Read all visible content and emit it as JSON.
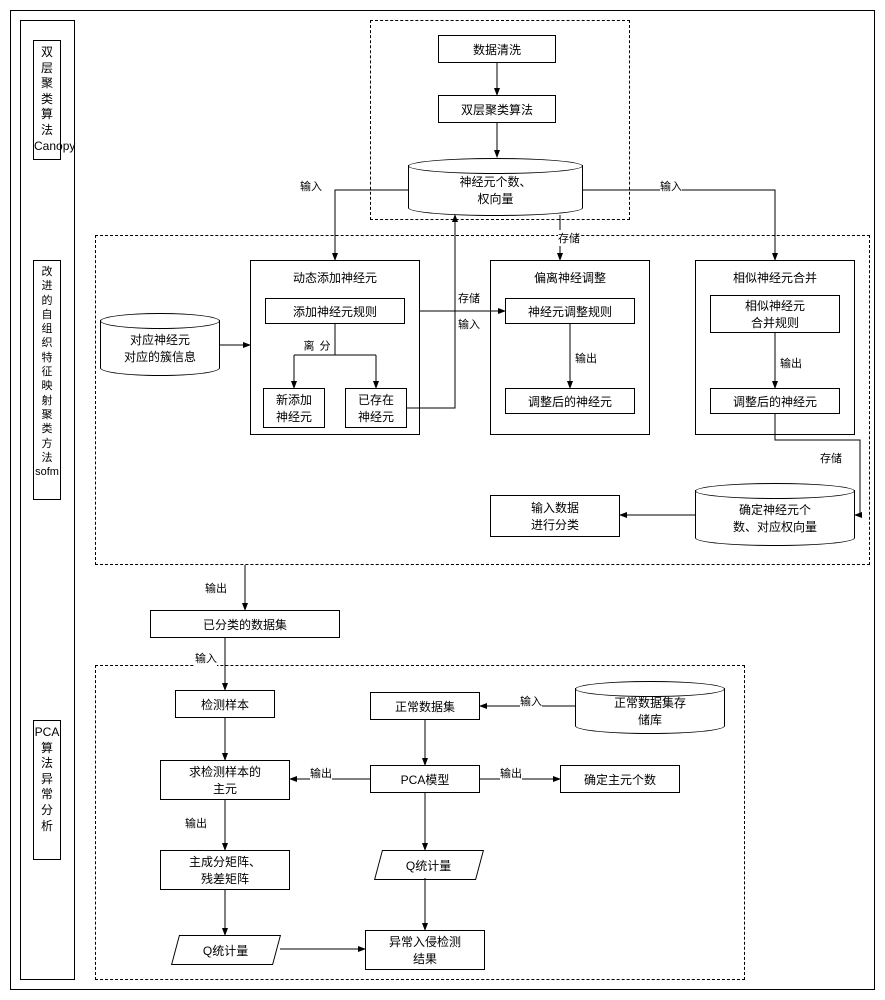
{
  "sections": {
    "canopy_label": "双层聚类算法Canopy",
    "sofm_label": "改进的自组织特征映射聚类方法sofm",
    "pca_label": "PCA算法异常分析"
  },
  "canopy": {
    "data_clean": "数据清洗",
    "bilayer_algo": "双层聚类算法",
    "neuron_store": "神经元个数、\n权向量"
  },
  "sofm": {
    "cluster_info": "对应神经元\n对应的簇信息",
    "dyn_add_title": "动态添加神经元",
    "add_rule": "添加神经元规则",
    "new_neuron": "新添加\n神经元",
    "exist_neuron": "已存在\n神经元",
    "adjust_title": "偏离神经调整",
    "adjust_rule": "神经元调整规则",
    "adjusted_neuron1": "调整后的神经元",
    "merge_title": "相似神经元合并",
    "merge_rule": "相似神经元\n合并规则",
    "adjusted_neuron2": "调整后的神经元",
    "final_store": "确定神经元个\n数、对应权向量",
    "classify": "输入数据\n进行分类"
  },
  "mid": {
    "classified_set": "已分类的数据集"
  },
  "pca": {
    "detect_sample": "检测样本",
    "seek_principal": "求检测样本的\n主元",
    "matrices": "主成分矩阵、\n残差矩阵",
    "q_stat1": "Q统计量",
    "normal_set": "正常数据集",
    "normal_store": "正常数据集存\n储库",
    "pca_model": "PCA模型",
    "num_principals": "确定主元个数",
    "q_stat2": "Q统计量",
    "result": "异常入侵检测\n结果"
  },
  "labels": {
    "input": "输入",
    "output": "输出",
    "store": "存储",
    "separate": "分离"
  }
}
